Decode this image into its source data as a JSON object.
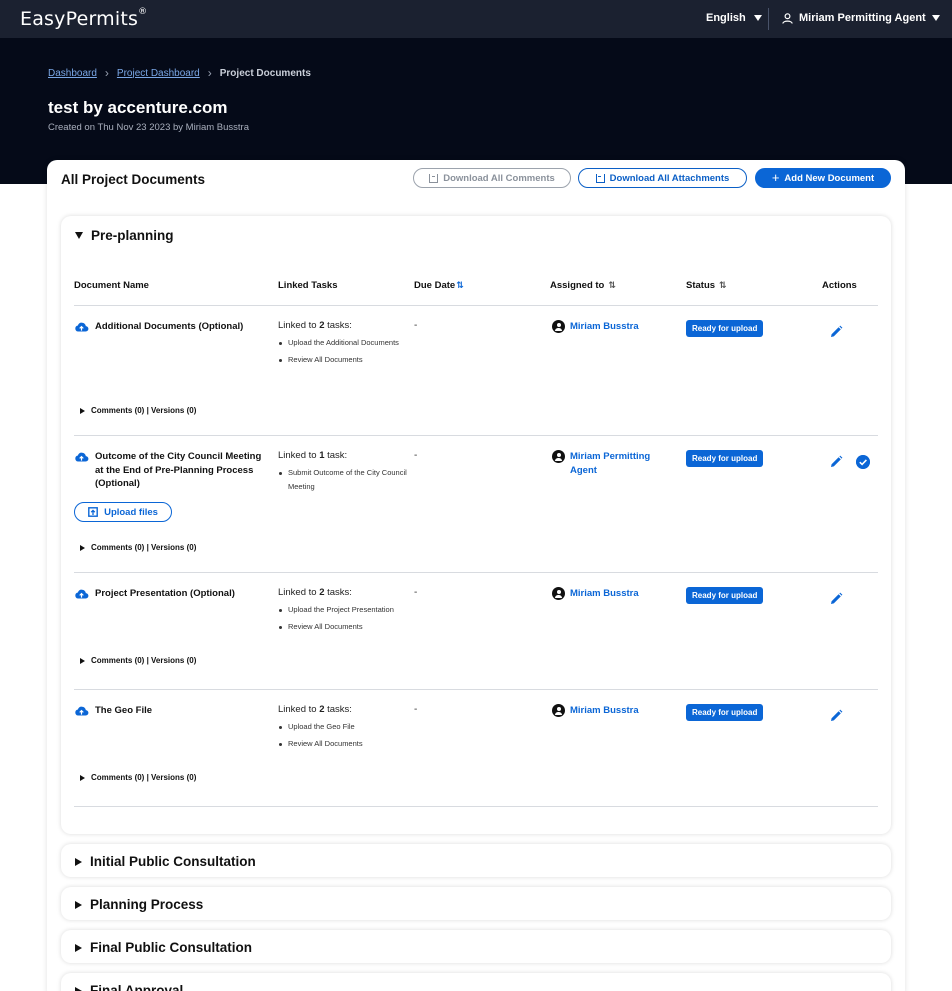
{
  "app": {
    "logo_text": "EasyPermits",
    "logo_mark": "®",
    "language": "English",
    "user_name": "Miriam Permitting Agent"
  },
  "breadcrumbs": [
    "Dashboard",
    "Project Dashboard",
    "Project Documents"
  ],
  "project": {
    "title": "test by accenture.com",
    "subtitle": "Created on Thu Nov 23 2023 by Miriam Busstra"
  },
  "documents_card": {
    "title": "All Project Documents",
    "download_comments_label": "Download All Comments",
    "download_attachments_label": "Download All Attachments",
    "add_document_label": "Add New Document"
  },
  "table_headers": {
    "document_name": "Document Name",
    "linked_tasks": "Linked Tasks",
    "due_date": "Due Date",
    "assigned_to": "Assigned to",
    "status": "Status",
    "actions": "Actions"
  },
  "sections": [
    {
      "title": "Pre-planning",
      "expanded": true
    },
    {
      "title": "Initial Public Consultation",
      "expanded": false
    },
    {
      "title": "Planning Process",
      "expanded": false
    },
    {
      "title": "Final Public Consultation",
      "expanded": false
    },
    {
      "title": "Final Approval",
      "expanded": false
    }
  ],
  "rows": [
    {
      "name": "Additional Documents (Optional)",
      "linked_prefix": "Linked to ",
      "linked_count": "2",
      "linked_suffix": " tasks:",
      "tasks": [
        "Upload the Additional Documents",
        "Review All Documents"
      ],
      "due": "-",
      "assignee": "Miriam Busstra",
      "status": "Ready for upload",
      "meta": "Comments (0) | Versions (0)"
    },
    {
      "name": "Outcome of the City Council Meeting at the End of Pre-Planning Process (Optional)",
      "linked_prefix": "Linked to ",
      "linked_count": "1",
      "linked_suffix": " task:",
      "tasks": [
        "Submit Outcome of the City Council Meeting"
      ],
      "due": "-",
      "assignee": "Miriam Permitting Agent",
      "status": "Ready for upload",
      "upload_label": "Upload files",
      "meta": "Comments (0) | Versions (0)"
    },
    {
      "name": "Project Presentation (Optional)",
      "linked_prefix": "Linked to ",
      "linked_count": "2",
      "linked_suffix": " tasks:",
      "tasks": [
        "Upload the Project Presentation",
        "Review All Documents"
      ],
      "due": "-",
      "assignee": "Miriam Busstra",
      "status": "Ready for upload",
      "meta": "Comments (0) | Versions (0)"
    },
    {
      "name": "The Geo File",
      "linked_prefix": "Linked to ",
      "linked_count": "2",
      "linked_suffix": " tasks:",
      "tasks": [
        "Upload the Geo File",
        "Review All Documents"
      ],
      "due": "-",
      "assignee": "Miriam Busstra",
      "status": "Ready for upload",
      "meta": "Comments (0) | Versions (0)"
    }
  ],
  "colors": {
    "topbar": "#1b2130",
    "hero": "#050a18",
    "accent": "#0b66d6",
    "link": "#7aa7e6"
  },
  "icons": {
    "language_dropdown": "caret-down-icon",
    "user": "user-icon",
    "breadcrumb_separator": "chevron-right-icon",
    "download": "download-icon",
    "add": "plus-icon",
    "expand": "triangle-icon",
    "sort": "sort-icon",
    "document_upload": "cloud-upload-icon",
    "assignee": "person-icon",
    "edit": "pencil-icon",
    "approve": "check-circle-icon"
  }
}
